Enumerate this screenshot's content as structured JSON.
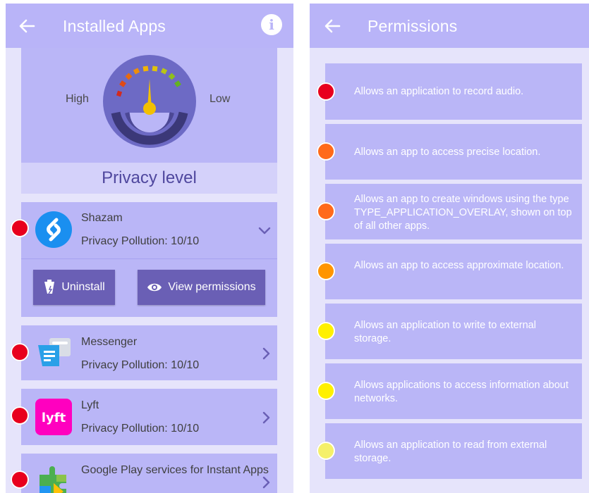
{
  "installed_apps_screen": {
    "title": "Installed Apps",
    "gauge": {
      "high_label": "High",
      "low_label": "Low"
    },
    "privacy_level_label": "Privacy level",
    "apps": [
      {
        "name": "Shazam",
        "pollution": "Privacy Pollution: 10/10",
        "expanded": true,
        "dot_color": "#e8001d"
      },
      {
        "name": "Messenger",
        "pollution": "Privacy Pollution: 10/10",
        "expanded": false,
        "dot_color": "#e8001d"
      },
      {
        "name": "Lyft",
        "pollution": "Privacy Pollution: 10/10",
        "expanded": false,
        "dot_color": "#e8001d"
      },
      {
        "name": "Google Play services for Instant Apps",
        "pollution": "",
        "expanded": false,
        "dot_color": "#e8001d"
      }
    ],
    "actions": {
      "uninstall_label": "Uninstall",
      "view_permissions_label": "View permissions"
    }
  },
  "permissions_screen": {
    "title": "Permissions",
    "permissions": [
      {
        "text": "Allows an application to record audio.",
        "dot_color": "#e8001d"
      },
      {
        "text": "Allows an app to access precise location.",
        "dot_color": "#ff6a1a"
      },
      {
        "text": "Allows an app to create windows using the type TYPE_APPLICATION_OVERLAY, shown on top of all other apps.",
        "dot_color": "#ff6a1a"
      },
      {
        "text": "Allows an app to access approximate location.",
        "dot_color": "#ff9500"
      },
      {
        "text": "Allows an application to write to external storage.",
        "dot_color": "#fff000"
      },
      {
        "text": "Allows applications to access information about networks.",
        "dot_color": "#fff000"
      },
      {
        "text": "Allows an application to read from external storage.",
        "dot_color": "#f5f06a"
      }
    ]
  },
  "colors": {
    "appbar": "#b9b4f8",
    "card": "#bab6f7",
    "background": "#e6e4fb",
    "button": "#6a5fb5",
    "accent_text": "#4f479e"
  },
  "icons": {
    "back": "arrow-left-icon",
    "info": "info-icon",
    "gauge": "speedometer-icon",
    "uninstall": "trash-icon",
    "view": "eye-icon",
    "expand": "chevron-down-icon",
    "open": "chevron-right-icon"
  }
}
